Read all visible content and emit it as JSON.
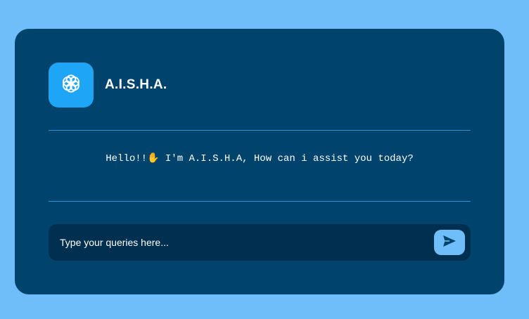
{
  "header": {
    "title": "A.I.S.H.A.",
    "logo_icon": "openai-knot-icon"
  },
  "chat": {
    "greeting_before": "Hello!!",
    "greeting_emoji": "✋",
    "greeting_after": " I'm A.I.S.H.A, How can i assist you today?"
  },
  "composer": {
    "placeholder": "Type your queries here...",
    "send_icon": "send-icon"
  },
  "colors": {
    "background": "#6fbdf9",
    "card": "#00436c",
    "logo_bg": "#1fa5f6",
    "input_bg": "#002f4f",
    "divider": "#2d8fd6",
    "send_button": "#6fbdf9"
  }
}
